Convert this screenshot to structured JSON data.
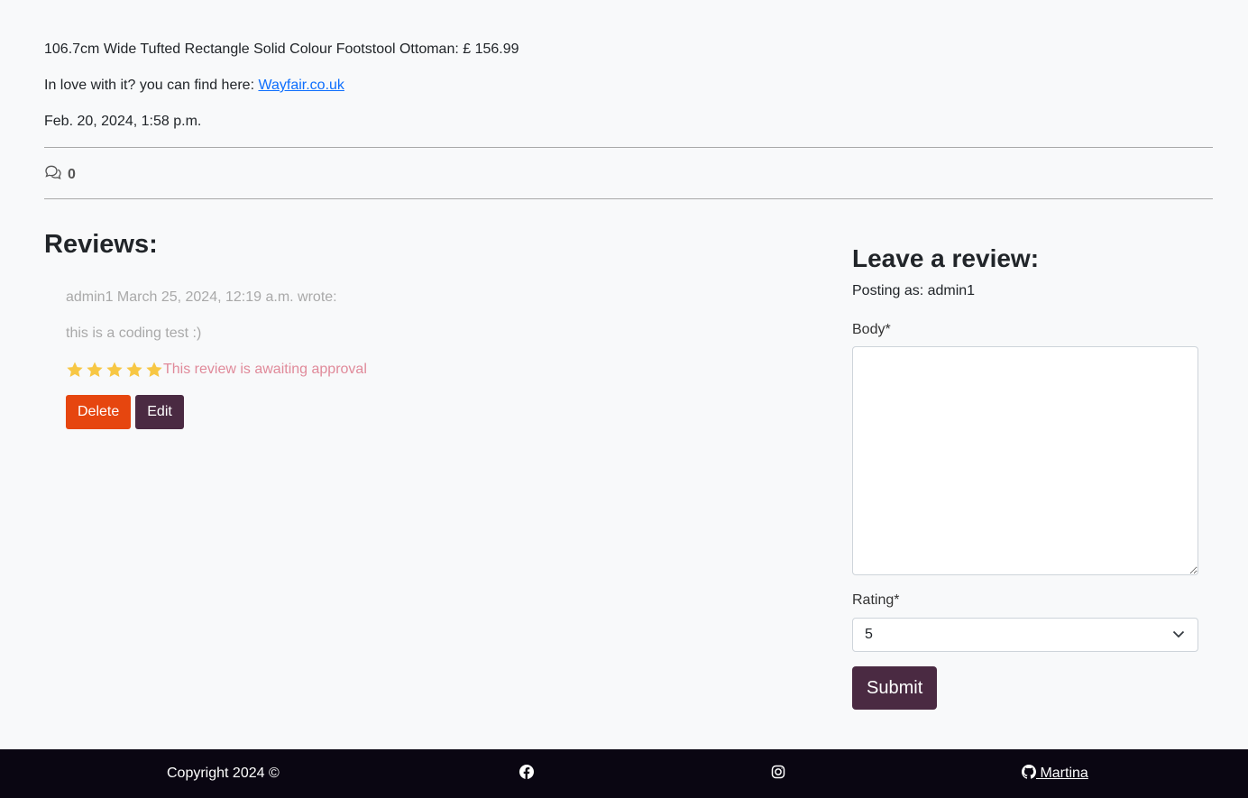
{
  "product": {
    "title_line": "106.7cm Wide Tufted Rectangle Solid Colour Footstool Ottoman: £ 156.99",
    "find_prefix": "In love with it? you can find here: ",
    "find_link": "Wayfair.co.uk",
    "date": "Feb. 20, 2024, 1:58 p.m."
  },
  "comments": {
    "count": "0",
    "icon": "chat-bubbles-icon"
  },
  "reviews": {
    "title": "Reviews:",
    "items": [
      {
        "meta": "admin1 March 25, 2024, 12:19 a.m. wrote:",
        "body": "this is a coding test :)",
        "stars": 5,
        "status": "This review is awaiting approval",
        "delete_label": "Delete",
        "edit_label": "Edit"
      }
    ]
  },
  "form": {
    "title": "Leave a review:",
    "posting_as": "Posting as: admin1",
    "body_label": "Body*",
    "body_value": "",
    "rating_label": "Rating*",
    "rating_value": "5",
    "submit_label": "Submit"
  },
  "footer": {
    "copyright": "Copyright 2024 ©",
    "github_label": " Martina",
    "icons": [
      "facebook-icon",
      "instagram-icon",
      "github-icon"
    ]
  },
  "colors": {
    "star": "#f7c744",
    "delete": "#e6460f",
    "edit": "#4a2a42",
    "submit": "#4a2a42",
    "footer_bg": "#0a0612",
    "pending": "#e08a9a",
    "link": "#0d6efd"
  }
}
